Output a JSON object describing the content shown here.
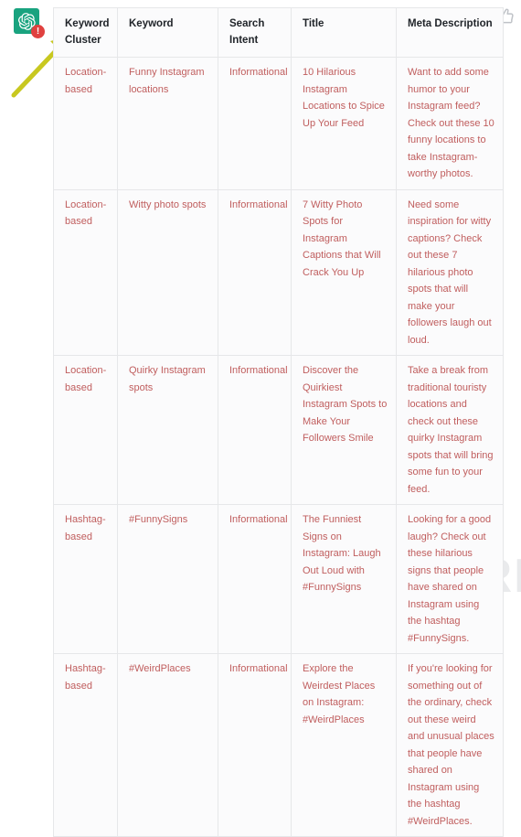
{
  "avatar": {
    "icon": "chatgpt-logo-icon",
    "background_color": "#19a37f",
    "badge": {
      "icon": "error-badge-icon",
      "label": "!",
      "color": "#e0413f"
    }
  },
  "annotation": {
    "arrow": {
      "icon": "arrow-up-right-icon",
      "color": "#c8c820",
      "points_to": "Keyword Cluster"
    }
  },
  "actions": {
    "thumbs_up": {
      "icon": "thumbs-up-icon",
      "label": "Good response"
    }
  },
  "watermark": {
    "text": "AIPRM",
    "color": "#e9eaec"
  },
  "table": {
    "name": "keyword-cluster-table",
    "columns": [
      "Keyword Cluster",
      "Keyword",
      "Search Intent",
      "Title",
      "Meta Description"
    ],
    "rows": [
      {
        "cluster": "Location-based",
        "keyword": "Funny Instagram locations",
        "intent": "Informational",
        "title": "10 Hilarious Instagram Locations to Spice Up Your Feed",
        "meta": "Want to add some humor to your Instagram feed? Check out these 10 funny locations to take Instagram-worthy photos."
      },
      {
        "cluster": "Location-based",
        "keyword": "Witty photo spots",
        "intent": "Informational",
        "title": "7 Witty Photo Spots for Instagram Captions that Will Crack You Up",
        "meta": "Need some inspiration for witty captions? Check out these 7 hilarious photo spots that will make your followers laugh out loud."
      },
      {
        "cluster": "Location-based",
        "keyword": "Quirky Instagram spots",
        "intent": "Informational",
        "title": "Discover the Quirkiest Instagram Spots to Make Your Followers Smile",
        "meta": "Take a break from traditional touristy locations and check out these quirky Instagram spots that will bring some fun to your feed."
      },
      {
        "cluster": "Hashtag-based",
        "keyword": "#FunnySigns",
        "intent": "Informational",
        "title": "The Funniest Signs on Instagram: Laugh Out Loud with #FunnySigns",
        "meta": "Looking for a good laugh? Check out these hilarious signs that people have shared on Instagram using the hashtag #FunnySigns."
      },
      {
        "cluster": "Hashtag-based",
        "keyword": "#WeirdPlaces",
        "intent": "Informational",
        "title": "Explore the Weirdest Places on Instagram: #WeirdPlaces",
        "meta": "If you're looking for something out of the ordinary, check out these weird and unusual places that people have shared on Instagram using the hashtag #WeirdPlaces."
      }
    ]
  }
}
